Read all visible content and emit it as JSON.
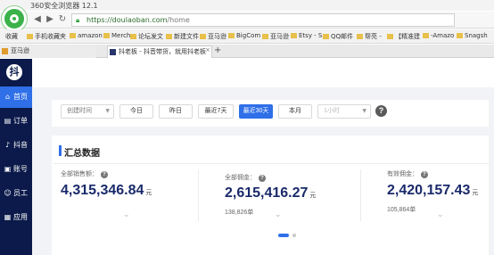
{
  "browser": {
    "title": "360安全浏览器 12.1",
    "url_secure": "https://doulaoban.com",
    "url_path": "/home",
    "back_icon": "arrow-left-icon",
    "forward_icon": "arrow-right-icon",
    "refresh_icon": "refresh-icon"
  },
  "bookmarks": [
    {
      "label": "收藏"
    },
    {
      "label": "手机收藏夹"
    },
    {
      "label": "amazon"
    },
    {
      "label": "Merch"
    },
    {
      "label": "论坛发文"
    },
    {
      "label": "新建文件"
    },
    {
      "label": "亚马逊"
    },
    {
      "label": "BigCom"
    },
    {
      "label": "亚马逊"
    },
    {
      "label": "Etsy - S"
    },
    {
      "label": "QQ邮件"
    },
    {
      "label": "帮亮 -"
    },
    {
      "label": "【精准建"
    },
    {
      "label": "-Amazo"
    },
    {
      "label": "Snagsh"
    }
  ],
  "tabs": [
    {
      "label": "亚马逊"
    },
    {
      "label": "抖老板 - 抖音带货，就用抖老板"
    }
  ],
  "tab_close": "×",
  "tab_new": "+",
  "sidebar": {
    "logo": "抖",
    "items": [
      {
        "label": "首页",
        "icon": "home-icon",
        "glyph": "⌂"
      },
      {
        "label": "订单",
        "icon": "order-icon",
        "glyph": "▤"
      },
      {
        "label": "抖音",
        "icon": "douyin-icon",
        "glyph": "♪"
      },
      {
        "label": "账号",
        "icon": "account-icon",
        "glyph": "▣"
      },
      {
        "label": "员工",
        "icon": "staff-icon",
        "glyph": "☺"
      },
      {
        "label": "应用",
        "icon": "apps-icon",
        "glyph": "▦"
      }
    ]
  },
  "filter": {
    "time_type": "创建时间",
    "buttons": [
      "今日",
      "昨日",
      "最近7天",
      "最近30天",
      "本月"
    ],
    "active_button": "最近30天",
    "range_placeholder": "1小时",
    "help_glyph": "?"
  },
  "summary": {
    "title": "汇总数据",
    "stats": [
      {
        "label": "全部销售额：",
        "value": "4,315,346.84",
        "unit": "元",
        "sub": ""
      },
      {
        "label": "全部佣金：",
        "value": "2,615,416.27",
        "unit": "元",
        "sub": "138,826单"
      },
      {
        "label": "有效佣金：",
        "value": "2,420,157.43",
        "unit": "元",
        "sub": "105,864单"
      }
    ],
    "qmark": "?",
    "chevron": "⌄"
  },
  "colors": {
    "sidebar_bg": "#0b1a4a",
    "accent": "#2f6fe8",
    "value_color": "#1a2a6a"
  }
}
